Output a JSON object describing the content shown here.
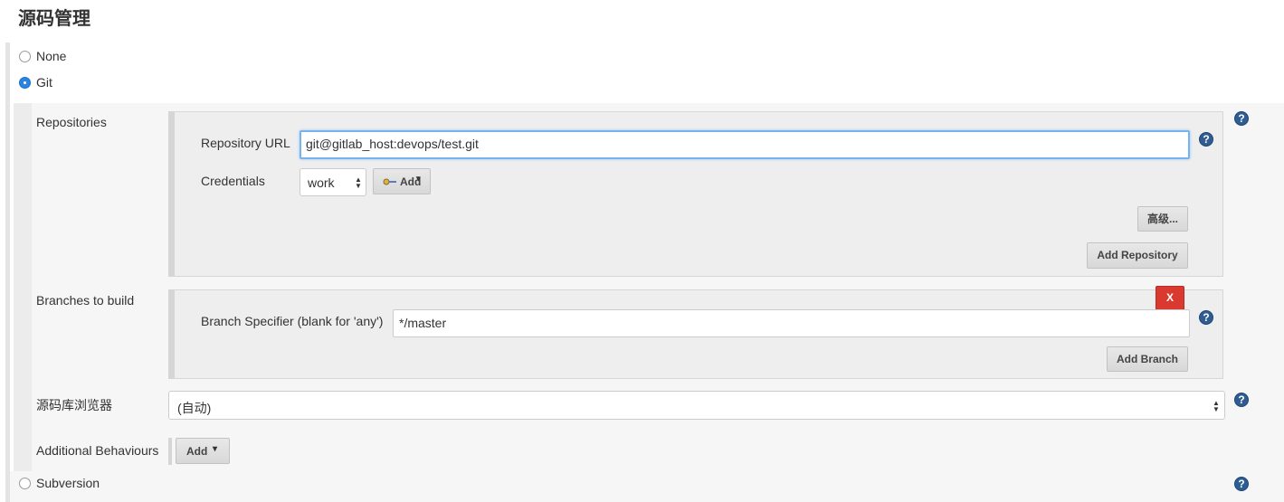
{
  "section_title": "源码管理",
  "scm_options": {
    "none": "None",
    "git": "Git",
    "subversion": "Subversion"
  },
  "git": {
    "repositories_label": "Repositories",
    "repository_url_label": "Repository URL",
    "repository_url_value": "git@gitlab_host:devops/test.git",
    "credentials_label": "Credentials",
    "credentials_value": "work",
    "add_credentials_label": "Add",
    "advanced_label": "高级...",
    "add_repository_label": "Add Repository",
    "branches_label": "Branches to build",
    "branch_specifier_label": "Branch Specifier (blank for 'any')",
    "branch_specifier_value": "*/master",
    "delete_branch_label": "X",
    "add_branch_label": "Add Branch",
    "repo_browser_label": "源码库浏览器",
    "repo_browser_value": "(自动)",
    "additional_behaviours_label": "Additional Behaviours",
    "add_behaviour_label": "Add"
  },
  "help_icon_glyph": "?"
}
